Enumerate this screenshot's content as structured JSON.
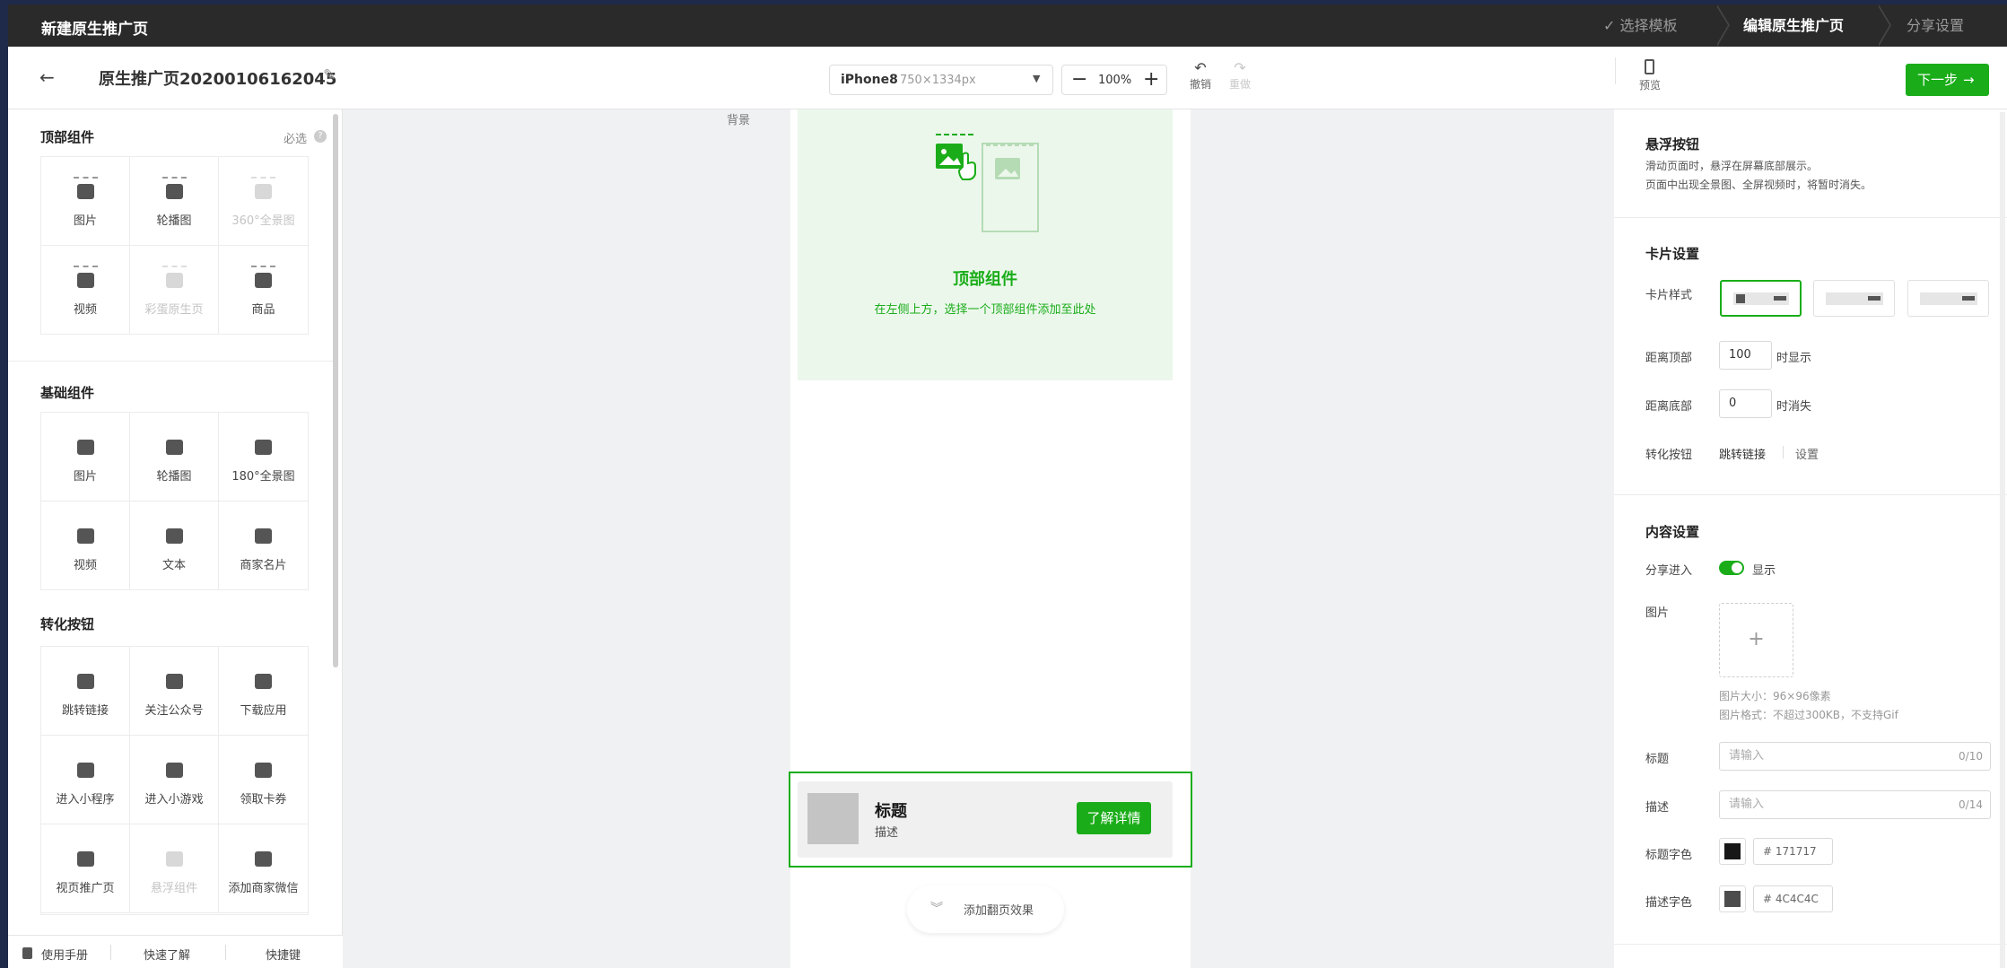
{
  "topbar": {
    "title": "新建原生推广页",
    "steps": [
      {
        "label": "✓ 选择模板"
      },
      {
        "label": "编辑原生推广页"
      },
      {
        "label": "分享设置"
      }
    ]
  },
  "toolbar": {
    "page_name": "原生推广页20200106162045",
    "device": "iPhone8",
    "device_size": "750×1334px",
    "zoom": "100%",
    "undo": "撤销",
    "redo": "重做",
    "preview": "预览",
    "next": "下一步"
  },
  "left": {
    "top_section": {
      "title": "顶部组件",
      "required": "必选",
      "items": [
        {
          "label": "图片",
          "disabled": false
        },
        {
          "label": "轮播图",
          "disabled": false
        },
        {
          "label": "360°全景图",
          "disabled": true
        },
        {
          "label": "视频",
          "disabled": false
        },
        {
          "label": "彩蛋原生页",
          "disabled": true
        },
        {
          "label": "商品",
          "disabled": false
        }
      ]
    },
    "basic_section": {
      "title": "基础组件",
      "items": [
        {
          "label": "图片",
          "disabled": false
        },
        {
          "label": "轮播图",
          "disabled": false
        },
        {
          "label": "180°全景图",
          "disabled": false
        },
        {
          "label": "视频",
          "disabled": false
        },
        {
          "label": "文本",
          "disabled": false
        },
        {
          "label": "商家名片",
          "disabled": false
        }
      ]
    },
    "convert_section": {
      "title": "转化按钮",
      "items": [
        {
          "label": "跳转链接",
          "disabled": false
        },
        {
          "label": "关注公众号",
          "disabled": false
        },
        {
          "label": "下载应用",
          "disabled": false
        },
        {
          "label": "进入小程序",
          "disabled": false
        },
        {
          "label": "进入小游戏",
          "disabled": false
        },
        {
          "label": "领取卡券",
          "disabled": false
        },
        {
          "label": "视页推广页",
          "disabled": false
        },
        {
          "label": "悬浮组件",
          "disabled": true
        },
        {
          "label": "添加商家微信",
          "disabled": false
        }
      ]
    },
    "footer": {
      "manual": "使用手册",
      "quick": "快速了解",
      "shortcuts": "快捷键"
    }
  },
  "canvas": {
    "bg_label": "背景",
    "top_title": "顶部组件",
    "top_hint": "在左侧上方，选择一个顶部组件添加至此处",
    "card_title": "标题",
    "card_desc": "描述",
    "card_button": "了解详情",
    "flip_effect": "添加翻页效果"
  },
  "right": {
    "title": "悬浮按钮",
    "desc1": "滑动页面时，悬浮在屏幕底部展示。",
    "desc2": "页面中出现全景图、全屏视频时，将暂时消失。",
    "card_settings": "卡片设置",
    "card_style_label": "卡片样式",
    "dist_top_label": "距离顶部",
    "dist_top_value": "100",
    "dist_top_suffix": "时显示",
    "dist_bottom_label": "距离底部",
    "dist_bottom_value": "0",
    "dist_bottom_suffix": "时消失",
    "convert_label": "转化按钮",
    "convert_value": "跳转链接",
    "convert_setting": "设置",
    "content_settings": "内容设置",
    "share_label": "分享进入",
    "share_value": "显示",
    "image_label": "图片",
    "image_size": "图片大小：96×96像素",
    "image_format": "图片格式：不超过300KB，不支持Gif",
    "title_label": "标题",
    "title_placeholder": "请输入",
    "title_count": "0/10",
    "desc_label": "描述",
    "desc_placeholder": "请输入",
    "desc_count": "0/14",
    "title_color_label": "标题字色",
    "title_color": "# 171717",
    "desc_color_label": "描述字色",
    "desc_color": "# 4C4C4C"
  },
  "colors": {
    "accent": "#1aad19",
    "topbar": "#2a2a2a",
    "title_swatch": "#171717",
    "desc_swatch": "#4c4c4c"
  }
}
